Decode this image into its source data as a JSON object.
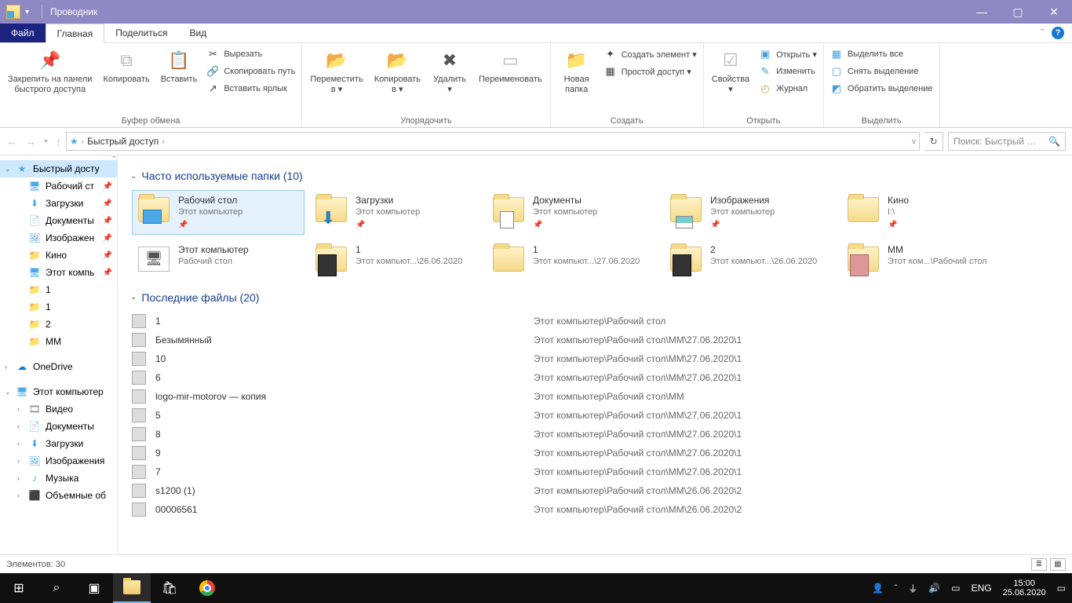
{
  "titlebar": {
    "title": "Проводник"
  },
  "tabs": {
    "file": "Файл",
    "home": "Главная",
    "share": "Поделиться",
    "view": "Вид"
  },
  "ribbon": {
    "clipboard": {
      "label": "Буфер обмена",
      "pin": "Закрепить на панели\nбыстрого доступа",
      "copy": "Копировать",
      "paste": "Вставить",
      "cut": "Вырезать",
      "copypath": "Скопировать путь",
      "pasteshortcut": "Вставить ярлык"
    },
    "organize": {
      "label": "Упорядочить",
      "moveto": "Переместить\nв ▾",
      "copyto": "Копировать\nв ▾",
      "delete": "Удалить\n▾",
      "rename": "Переименовать"
    },
    "create": {
      "label": "Создать",
      "newfolder": "Новая\nпапка",
      "newitem": "Создать элемент ▾",
      "easyaccess": "Простой доступ ▾"
    },
    "open": {
      "label": "Открыть",
      "properties": "Свойства\n▾",
      "open": "Открыть ▾",
      "edit": "Изменить",
      "history": "Журнал"
    },
    "select": {
      "label": "Выделить",
      "selectall": "Выделить все",
      "selectnone": "Снять выделение",
      "invert": "Обратить выделение"
    }
  },
  "address": {
    "label": "Быстрый доступ"
  },
  "search": {
    "placeholder": "Поиск: Быстрый …"
  },
  "nav": {
    "quick": "Быстрый досту",
    "desktop": "Рабочий ст",
    "downloads": "Загрузки",
    "documents": "Документы",
    "pictures": "Изображен",
    "movies": "Кино",
    "thispc_q": "Этот компь",
    "f1": "1",
    "f1b": "1",
    "f2": "2",
    "mm": "MM",
    "onedrive": "OneDrive",
    "thispc": "Этот компьютер",
    "videos": "Видео",
    "documents2": "Документы",
    "downloads2": "Загрузки",
    "pictures2": "Изображения",
    "music": "Музыка",
    "obj3d": "Объемные об"
  },
  "sections": {
    "frequent": "Часто используемые папки (10)",
    "recent": "Последние файлы (20)"
  },
  "folders": [
    {
      "name": "Рабочий стол",
      "sub": "Этот компьютер",
      "pin": true,
      "sel": true,
      "icon": "desktop"
    },
    {
      "name": "Загрузки",
      "sub": "Этот компьютер",
      "pin": true,
      "icon": "downloads"
    },
    {
      "name": "Документы",
      "sub": "Этот компьютер",
      "pin": true,
      "icon": "docs"
    },
    {
      "name": "Изображения",
      "sub": "Этот компьютер",
      "pin": true,
      "icon": "pics"
    },
    {
      "name": "Кино",
      "sub": "I:\\",
      "pin": true,
      "icon": "folder"
    },
    {
      "name": "Этот компьютер",
      "sub": "Рабочий стол",
      "icon": "pc"
    },
    {
      "name": "1",
      "sub": "Этот компьют...\\26.06.2020",
      "icon": "thumb"
    },
    {
      "name": "1",
      "sub": "Этот компьют...\\27.06.2020",
      "icon": "folder"
    },
    {
      "name": "2",
      "sub": "Этот компьют...\\26.06.2020",
      "icon": "thumb"
    },
    {
      "name": "MM",
      "sub": "Этот ком...\\Рабочий стол",
      "icon": "thumb2"
    }
  ],
  "recent": [
    {
      "name": "1",
      "path": "Этот компьютер\\Рабочий стол"
    },
    {
      "name": "Безымянный",
      "path": "Этот компьютер\\Рабочий стол\\MM\\27.06.2020\\1"
    },
    {
      "name": "10",
      "path": "Этот компьютер\\Рабочий стол\\MM\\27.06.2020\\1"
    },
    {
      "name": "6",
      "path": "Этот компьютер\\Рабочий стол\\MM\\27.06.2020\\1"
    },
    {
      "name": "logo-mir-motorov — копия",
      "path": "Этот компьютер\\Рабочий стол\\MM"
    },
    {
      "name": "5",
      "path": "Этот компьютер\\Рабочий стол\\MM\\27.06.2020\\1"
    },
    {
      "name": "8",
      "path": "Этот компьютер\\Рабочий стол\\MM\\27.06.2020\\1"
    },
    {
      "name": "9",
      "path": "Этот компьютер\\Рабочий стол\\MM\\27.06.2020\\1"
    },
    {
      "name": "7",
      "path": "Этот компьютер\\Рабочий стол\\MM\\27.06.2020\\1"
    },
    {
      "name": "s1200 (1)",
      "path": "Этот компьютер\\Рабочий стол\\MM\\26.06.2020\\2"
    },
    {
      "name": "00006561",
      "path": "Этот компьютер\\Рабочий стол\\MM\\26.06.2020\\2"
    }
  ],
  "status": {
    "items": "Элементов: 30"
  },
  "taskbar": {
    "lang": "ENG",
    "time": "15:00",
    "date": "25.06.2020"
  }
}
